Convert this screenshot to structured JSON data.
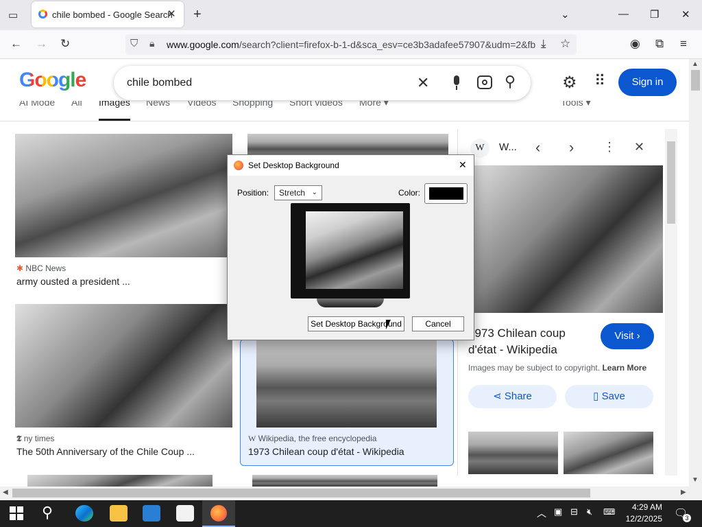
{
  "browser": {
    "tab_title": "chile bombed - Google Search",
    "tab_close": "✕",
    "new_tab": "+",
    "url_prefix": "www.google.com",
    "url_rest": "/search?client=firefox-b-1-d&sca_esv=ce3b3adafee57907&udm=2&fb"
  },
  "google": {
    "logo": "Google",
    "query": "chile bombed",
    "sign_in": "Sign in",
    "tabs": [
      "AI Mode",
      "All",
      "Images",
      "News",
      "Videos",
      "Shopping",
      "Short videos",
      "More ▾",
      "Tools ▾"
    ]
  },
  "results": [
    {
      "source": "NBC News",
      "caption": "army ousted a president ..."
    },
    {
      "source": "ny times",
      "caption": "The 50th Anniversary of the Chile Coup ..."
    },
    {
      "source": "Wikipedia, the free encyclopedia",
      "caption": "1973 Chilean coup d'état - Wikipedia"
    }
  ],
  "panel": {
    "site": "W...",
    "title": "1973 Chilean coup d'état - Wikipedia",
    "visit": "Visit ›",
    "copyright": "Images may be subject to copyright.",
    "learn_more": "Learn More",
    "share": "Share",
    "save": "Save"
  },
  "dialog": {
    "title": "Set Desktop Background",
    "position_label": "Position:",
    "position_value": "Stretch",
    "color_label": "Color:",
    "color_value": "#000000",
    "set_button": "Set Desktop Background",
    "cancel_button": "Cancel",
    "close": "✕"
  },
  "taskbar": {
    "time": "4:29 AM",
    "date": "12/2/2025",
    "notification_count": "3"
  },
  "colors": {
    "accent": "#0b57d0",
    "selection_border": "#4285f4"
  }
}
